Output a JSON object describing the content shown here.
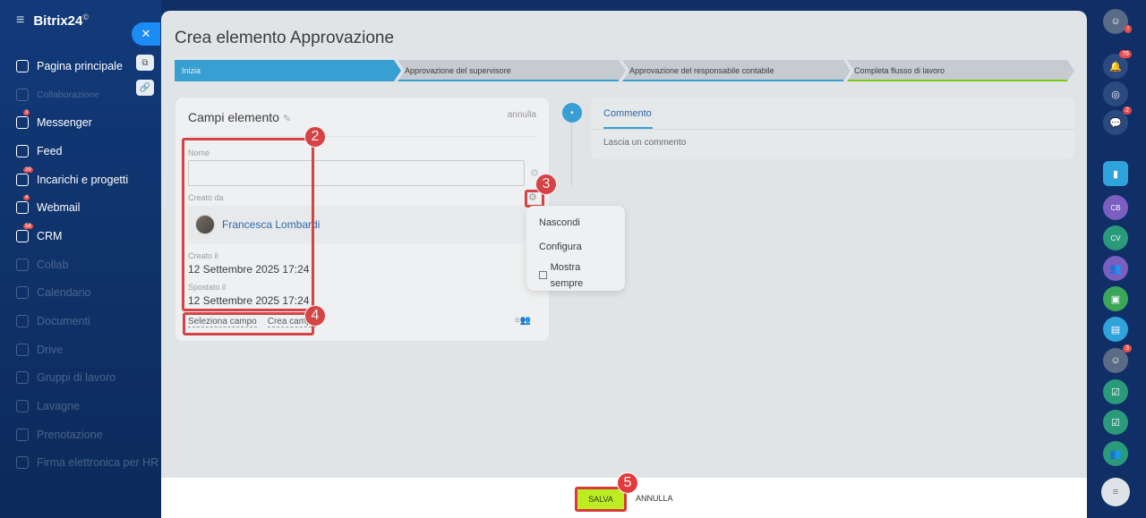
{
  "sidebar": {
    "logo": "Bitrix24",
    "logo_sup": "©",
    "items": [
      {
        "label": "Pagina principale",
        "dim": false,
        "badge": ""
      },
      {
        "label": "Collaborazione",
        "dim": true,
        "badge": ""
      },
      {
        "label": "Messenger",
        "dim": false,
        "badge": "3"
      },
      {
        "label": "Feed",
        "dim": false,
        "badge": ""
      },
      {
        "label": "Incarichi e progetti",
        "dim": false,
        "badge": "39"
      },
      {
        "label": "Webmail",
        "dim": false,
        "badge": "4"
      },
      {
        "label": "CRM",
        "dim": false,
        "badge": "58"
      },
      {
        "label": "Collab",
        "dim": true,
        "badge": ""
      },
      {
        "label": "Calendario",
        "dim": true,
        "badge": ""
      },
      {
        "label": "Documenti",
        "dim": true,
        "badge": ""
      },
      {
        "label": "Drive",
        "dim": true,
        "badge": ""
      },
      {
        "label": "Gruppi di lavoro",
        "dim": true,
        "badge": ""
      },
      {
        "label": "Lavagne",
        "dim": true,
        "badge": ""
      },
      {
        "label": "Prenotazione",
        "dim": true,
        "badge": ""
      },
      {
        "label": "Firma elettronica per HR",
        "dim": true,
        "badge": ""
      }
    ]
  },
  "slider": {
    "title": "Crea elemento Approvazione",
    "stages": [
      {
        "label": "Inizia",
        "active": true,
        "line": "#2fa3dc"
      },
      {
        "label": "Approvazione del supervisore",
        "active": false,
        "line": "#2fa3dc"
      },
      {
        "label": "Approvazione del responsabile contabile",
        "active": false,
        "line": "#2fa3dc"
      },
      {
        "label": "Completa flusso di lavoro",
        "active": false,
        "line": "#7bd500"
      }
    ]
  },
  "card": {
    "title": "Campi elemento",
    "cancel": "annulla",
    "name_label": "Nome",
    "name_value": "",
    "created_by_label": "Creato da",
    "created_by": "Francesca Lombardi",
    "created_on_label": "Creato il",
    "created_on": "12 Settembre 2025 17:24",
    "moved_on_label": "Spostato il",
    "moved_on": "12 Settembre 2025 17:24",
    "select_field": "Seleziona campo",
    "create_field": "Crea campo"
  },
  "popup": {
    "hide": "Nascondi",
    "configure": "Configura",
    "always_show": "Mostra sempre"
  },
  "comment": {
    "tab": "Commento",
    "placeholder": "Lascia un commento"
  },
  "footer": {
    "save": "SALVA",
    "cancel": "ANNULLA"
  },
  "annotations": [
    "2",
    "3",
    "4",
    "5"
  ],
  "colors": {
    "accent": "#2fa3dc",
    "save_button": "#bbed21",
    "annotation": "#e23b3b"
  },
  "rail": {
    "notifications_badge": "76",
    "chat_badge": "2",
    "user_badge": "3",
    "avatar_labels": [
      "CB",
      "CV"
    ]
  }
}
